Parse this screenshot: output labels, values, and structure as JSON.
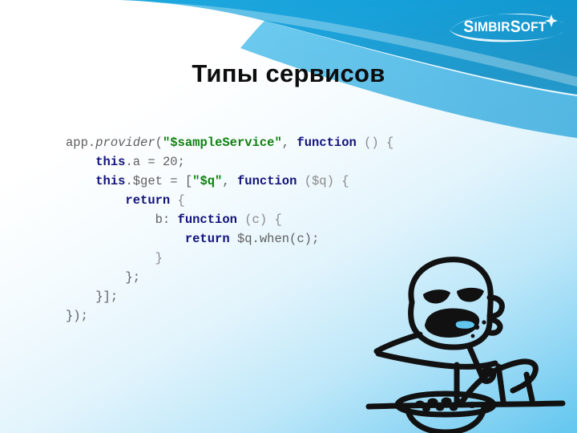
{
  "slide": {
    "title": "Типы сервисов",
    "brand": {
      "name": "SimbirSoft",
      "parts": [
        "S",
        "IMBIR",
        "S",
        "OFT"
      ],
      "color": "#ffffff"
    },
    "background": {
      "top_left": "#ffffff",
      "bottom_right": "#63c6ef",
      "banner_blue": "#18a5dc",
      "banner_blue_dark": "#0f8fc6"
    }
  },
  "code": {
    "language": "javascript",
    "colors": {
      "plain": "#5f5f5f",
      "keyword": "#12127a",
      "string": "#108010",
      "punctuation": "#8a8a8a"
    },
    "lines": [
      {
        "indent": "",
        "tokens": [
          {
            "text": "app.",
            "type": "plain"
          },
          {
            "text": "provider",
            "type": "fn"
          },
          {
            "text": "(",
            "type": "plain"
          },
          {
            "text": "\"$sampleService\"",
            "type": "string"
          },
          {
            "text": ", ",
            "type": "plain"
          },
          {
            "text": "function",
            "type": "keyword"
          },
          {
            "text": " () {",
            "type": "punct"
          }
        ]
      },
      {
        "indent": "    ",
        "tokens": [
          {
            "text": "this",
            "type": "keyword"
          },
          {
            "text": ".a = 20;",
            "type": "plain"
          }
        ]
      },
      {
        "indent": "    ",
        "tokens": [
          {
            "text": "this",
            "type": "keyword"
          },
          {
            "text": ".$get = [",
            "type": "plain"
          },
          {
            "text": "\"$q\"",
            "type": "string"
          },
          {
            "text": ", ",
            "type": "plain"
          },
          {
            "text": "function",
            "type": "keyword"
          },
          {
            "text": " ($q) {",
            "type": "punct"
          }
        ]
      },
      {
        "indent": "        ",
        "tokens": [
          {
            "text": "return",
            "type": "keyword"
          },
          {
            "text": " {",
            "type": "punct"
          }
        ]
      },
      {
        "indent": "            ",
        "tokens": [
          {
            "text": "b: ",
            "type": "plain"
          },
          {
            "text": "function",
            "type": "keyword"
          },
          {
            "text": " (c) {",
            "type": "punct"
          }
        ]
      },
      {
        "indent": "                ",
        "tokens": [
          {
            "text": "return",
            "type": "keyword"
          },
          {
            "text": " $q.when(c);",
            "type": "plain"
          }
        ]
      },
      {
        "indent": "            ",
        "tokens": [
          {
            "text": "}",
            "type": "punct"
          }
        ]
      },
      {
        "indent": "        ",
        "tokens": [
          {
            "text": "};",
            "type": "plain"
          }
        ]
      },
      {
        "indent": "    ",
        "tokens": [
          {
            "text": "}];",
            "type": "plain"
          }
        ]
      },
      {
        "indent": "",
        "tokens": [
          {
            "text": "});",
            "type": "plain"
          }
        ]
      }
    ]
  },
  "illustration": {
    "name": "cereal-guy",
    "description": "Line drawing of a face with an arm reaching over a bowl of cereal with a spoon",
    "stroke_color": "#111111"
  }
}
